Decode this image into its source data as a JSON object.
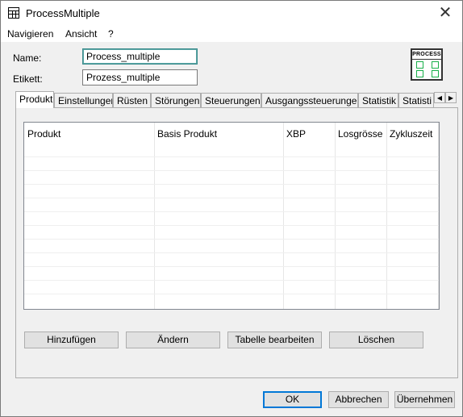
{
  "window": {
    "title": "ProcessMultiple",
    "close_label": "✕"
  },
  "menu": [
    "Navigieren",
    "Ansicht",
    "?"
  ],
  "form": {
    "name_label": "Name:",
    "name_value": "Process_multiple",
    "label_label": "Etikett:",
    "label_value": "Prozess_multiple"
  },
  "process_icon": {
    "caption": "PROCESS",
    "color": "#19b04a"
  },
  "tabs": [
    {
      "label": "Produkt",
      "active": true
    },
    {
      "label": "Einstellungen"
    },
    {
      "label": "Rüsten"
    },
    {
      "label": "Störungen"
    },
    {
      "label": "Steuerungen"
    },
    {
      "label": "Ausgangssteuerungen"
    },
    {
      "label": "Statistik"
    },
    {
      "label": "Statisti"
    }
  ],
  "tab_scroll": {
    "left": "◀",
    "right": "▶"
  },
  "table": {
    "columns": [
      "Produkt",
      "Basis Produkt",
      "XBP",
      "Losgrösse",
      "Zykluszeit"
    ],
    "rows": []
  },
  "table_buttons": {
    "add": "Hinzufügen",
    "change": "Ändern",
    "edit_table": "Tabelle bearbeiten",
    "delete": "Löschen"
  },
  "dialog_buttons": {
    "ok": "OK",
    "cancel": "Abbrechen",
    "apply": "Übernehmen"
  }
}
